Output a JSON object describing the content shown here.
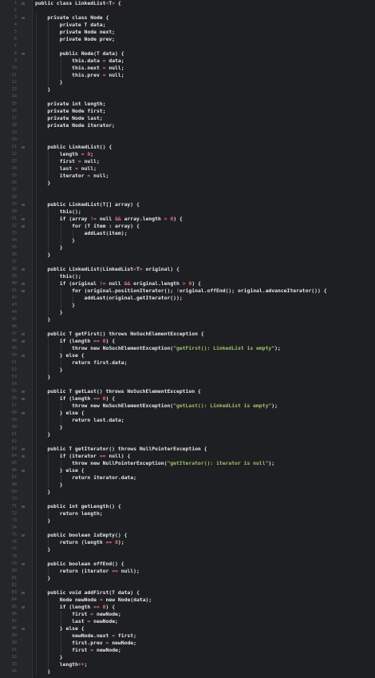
{
  "editor": {
    "lines": [
      "public class LinkedList<T> {",
      "",
      "    private class Node {",
      "        private T data;",
      "        private Node next;",
      "        private Node prev;",
      "",
      "        public Node(T data) {",
      "            this.data = data;",
      "            this.next = null;",
      "            this.prev = null;",
      "        }",
      "    }",
      "",
      "    private int length;",
      "    private Node first;",
      "    private Node last;",
      "    private Node iterator;",
      "",
      "",
      "    public LinkedList() {",
      "        length = 0;",
      "        first = null;",
      "        last = null;",
      "        iterator = null;",
      "    }",
      "",
      "",
      "    public LinkedList(T[] array) {",
      "        this();",
      "        if (array != null && array.length > 0) {",
      "            for (T item : array) {",
      "                addLast(item);",
      "            }",
      "        }",
      "    }",
      "",
      "    public LinkedList(LinkedList<T> original) {",
      "        this();",
      "        if (original != null && original.length > 0) {",
      "            for (original.positionIterator(); !original.offEnd(); original.advanceIterator()) {",
      "                addLast(original.getIterator());",
      "            }",
      "        }",
      "    }",
      "",
      "    public T getFirst() throws NoSuchElementException {",
      "        if (length == 0) {",
      "            throw new NoSuchElementException(\"getFirst(): LinkedList is empty\");",
      "        } else {",
      "            return first.data;",
      "        }",
      "    }",
      "",
      "    public T getLast() throws NoSuchElementException {",
      "        if (length == 0) {",
      "            throw new NoSuchElementException(\"getLast(): LinkedList is empty\");",
      "        } else {",
      "            return last.data;",
      "        }",
      "    }",
      "",
      "    public T getIterator() throws NullPointerException {",
      "        if (iterator == null) {",
      "            throw new NullPointerException(\"getIterator(): iterator is null\");",
      "        } else {",
      "            return iterator.data;",
      "        }",
      "    }",
      "",
      "    public int getLength() {",
      "        return length;",
      "    }",
      "",
      "    public boolean isEmpty() {",
      "        return (length == 0);",
      "    }",
      "",
      "    public boolean offEnd() {",
      "        return (iterator == null);",
      "    }",
      "",
      "    public void addFirst(T data) {",
      "        Node newNode = new Node(data);",
      "        if (length == 0) {",
      "            first = newNode;",
      "            last = newNode;",
      "        } else {",
      "            newNode.next = first;",
      "            first.prev = newNode;",
      "            first = newNode;",
      "        }",
      "        length++;",
      "    }"
    ],
    "colors": {
      "background": "#1e1f22",
      "gutter": "#25262a",
      "text": "#e8e8e8",
      "number": "#e8775e",
      "string": "#9fc46a",
      "operator": "#d9748d",
      "line_number": "#5b5f66"
    }
  }
}
